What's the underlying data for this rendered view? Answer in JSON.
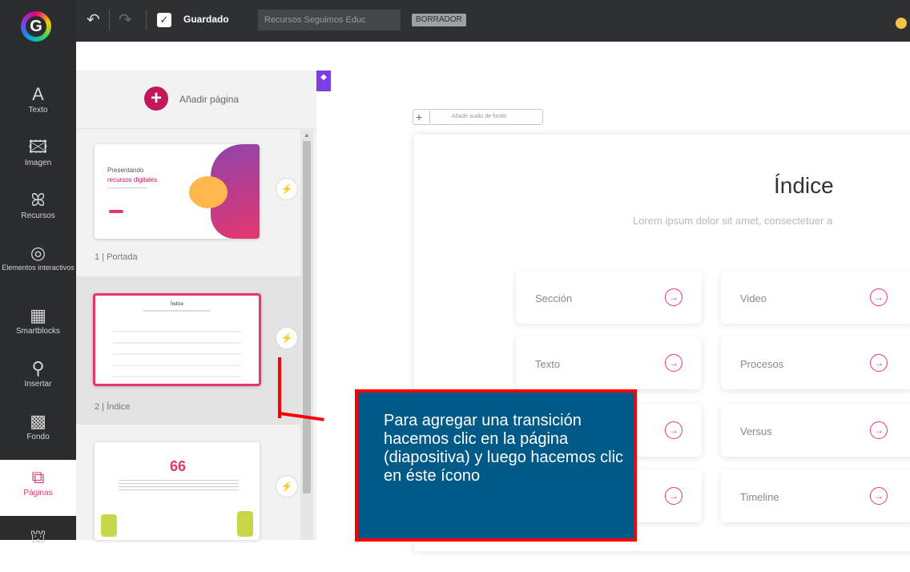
{
  "topbar": {
    "undo_icon": "undo-icon",
    "redo_icon": "redo-icon",
    "saved_label": "Guardado",
    "title_value": "Recursos Seguimos Educ",
    "draft_badge": "BORRADOR"
  },
  "sidebar": {
    "items": [
      {
        "label": "Texto",
        "icon": "A"
      },
      {
        "label": "Imagen",
        "icon": "🖾"
      },
      {
        "label": "Recursos",
        "icon": "ꕤ"
      },
      {
        "label": "Elementos interactivos",
        "icon": "◎"
      },
      {
        "label": "Smartblocks",
        "icon": "▦"
      },
      {
        "label": "Insertar",
        "icon": "⚲"
      },
      {
        "label": "Fondo",
        "icon": "▩"
      },
      {
        "label": "Páginas",
        "icon": "⧉"
      },
      {
        "label": "",
        "icon": "⛫"
      }
    ]
  },
  "pages_panel": {
    "add_label": "Añadir página",
    "pages": [
      {
        "label": "1 | Portada",
        "thumb_title": "Presentando",
        "thumb_subtitle": "recursos digitales"
      },
      {
        "label": "2 | Índice",
        "thumb_title": "Índice"
      },
      {
        "label": "",
        "thumb_quote": "66"
      }
    ]
  },
  "canvas": {
    "audio_label": "Añade audio de fondo",
    "slide_title": "Índice",
    "slide_subtitle": "Lorem ipsum dolor sit amet, consectetuer a",
    "cards": [
      {
        "label": "Sección"
      },
      {
        "label": "Video"
      },
      {
        "label": "Texto"
      },
      {
        "label": "Procesos"
      },
      {
        "label": ""
      },
      {
        "label": "Versus"
      },
      {
        "label": ""
      },
      {
        "label": "Timeline"
      }
    ]
  },
  "annotation": {
    "text": "Para agregar una transición hacemos clic en la página (diapositiva) y luego hacemos clic en éste ícono"
  },
  "colors": {
    "accent": "#e5376d",
    "topbar": "#2f3033",
    "callout_bg": "#005a87",
    "callout_border": "#ff0000"
  }
}
